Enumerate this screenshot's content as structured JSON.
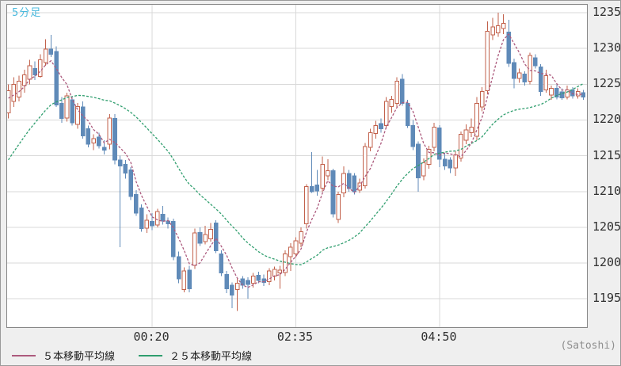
{
  "title": "5分足",
  "unit_label": "(Satoshi)",
  "legend": [
    {
      "label": "５本移動平均線",
      "color": "#ac5a7d"
    },
    {
      "label": "２５本移動平均線",
      "color": "#2f9e6e"
    }
  ],
  "colors": {
    "up": "#c2614b",
    "down": "#5f8ab8",
    "ma5": "#ac5a7d",
    "ma25": "#2f9e6e",
    "grid": "#d9d9d9",
    "title": "#4ab9dd",
    "axis_text": "#303030",
    "unit_text": "#8f8f8f",
    "plot_border": "#858585",
    "background": "#efefef",
    "plot_bg": "#ffffff"
  },
  "chart_data": {
    "type": "candlestick",
    "interval_label": "5分足",
    "x_axis": {
      "tick_labels": [
        "00:20",
        "02:35",
        "04:50"
      ],
      "tick_candle_indices": [
        27,
        54,
        81
      ]
    },
    "y_axis": {
      "min": 1195,
      "max": 1235,
      "ticks": [
        1235,
        1230,
        1225,
        1220,
        1215,
        1210,
        1205,
        1200,
        1195
      ],
      "unit": "Satoshi"
    },
    "series_legend": [
      "５本移動平均線",
      "２５本移動平均線"
    ],
    "ma5_period": 5,
    "ma25_period": 25,
    "ma_seed_closes": [
      1197.0,
      1198.5,
      1200.0,
      1202.0,
      1204.0,
      1206.0,
      1208.0,
      1210.0,
      1212.0,
      1213.5,
      1215.0,
      1216.5,
      1217.5,
      1218.5,
      1219.5,
      1220.5,
      1221.0,
      1221.5,
      1222.0,
      1222.5,
      1222.8,
      1223.0,
      1222.8,
      1222.5
    ],
    "candles_ohlc": [
      [
        1221.0,
        1225.0,
        1220.2,
        1224.1
      ],
      [
        1222.6,
        1226.0,
        1221.8,
        1225.0
      ],
      [
        1223.2,
        1226.2,
        1222.6,
        1225.4
      ],
      [
        1224.8,
        1227.0,
        1223.8,
        1226.3
      ],
      [
        1225.7,
        1228.4,
        1225.0,
        1227.6
      ],
      [
        1227.2,
        1228.2,
        1225.6,
        1226.3
      ],
      [
        1226.1,
        1229.2,
        1225.9,
        1228.4
      ],
      [
        1228.0,
        1231.3,
        1227.6,
        1229.9
      ],
      [
        1229.9,
        1231.9,
        1228.8,
        1229.2
      ],
      [
        1229.6,
        1230.3,
        1221.8,
        1222.1
      ],
      [
        1222.3,
        1223.2,
        1219.6,
        1220.2
      ],
      [
        1220.3,
        1223.8,
        1219.8,
        1223.4
      ],
      [
        1222.8,
        1223.2,
        1219.2,
        1219.6
      ],
      [
        1219.4,
        1222.4,
        1218.8,
        1221.9
      ],
      [
        1221.8,
        1222.6,
        1217.4,
        1217.8
      ],
      [
        1218.8,
        1219.2,
        1216.2,
        1216.6
      ],
      [
        1216.8,
        1218.0,
        1215.8,
        1217.4
      ],
      [
        1217.6,
        1218.2,
        1216.0,
        1216.4
      ],
      [
        1216.2,
        1217.2,
        1215.2,
        1215.8
      ],
      [
        1216.6,
        1220.8,
        1215.9,
        1220.3
      ],
      [
        1220.2,
        1220.8,
        1213.8,
        1214.4
      ],
      [
        1214.4,
        1215.0,
        1202.2,
        1213.6
      ],
      [
        1213.8,
        1214.4,
        1211.8,
        1212.6
      ],
      [
        1213.0,
        1213.4,
        1208.8,
        1209.3
      ],
      [
        1209.6,
        1210.2,
        1206.6,
        1207.0
      ],
      [
        1207.7,
        1208.2,
        1204.4,
        1204.8
      ],
      [
        1204.9,
        1206.8,
        1204.2,
        1206.0
      ],
      [
        1205.8,
        1207.0,
        1204.6,
        1205.2
      ],
      [
        1205.3,
        1207.6,
        1205.0,
        1207.2
      ],
      [
        1206.8,
        1208.0,
        1205.4,
        1205.9
      ],
      [
        1205.9,
        1206.4,
        1204.8,
        1205.5
      ],
      [
        1205.8,
        1206.2,
        1200.4,
        1200.9
      ],
      [
        1200.9,
        1201.6,
        1197.2,
        1197.8
      ],
      [
        1196.3,
        1199.4,
        1195.9,
        1198.9
      ],
      [
        1199.0,
        1199.6,
        1195.9,
        1196.4
      ],
      [
        1199.7,
        1204.8,
        1199.2,
        1204.2
      ],
      [
        1204.3,
        1205.0,
        1202.4,
        1202.8
      ],
      [
        1203.0,
        1205.2,
        1202.6,
        1204.0
      ],
      [
        1203.4,
        1205.6,
        1203.0,
        1204.7
      ],
      [
        1205.6,
        1206.0,
        1201.4,
        1201.7
      ],
      [
        1201.3,
        1201.8,
        1198.2,
        1198.6
      ],
      [
        1198.4,
        1198.9,
        1195.8,
        1196.4
      ],
      [
        1196.9,
        1197.3,
        1193.7,
        1195.5
      ],
      [
        1196.3,
        1197.8,
        1193.3,
        1197.2
      ],
      [
        1197.8,
        1198.2,
        1196.4,
        1196.9
      ],
      [
        1197.6,
        1198.0,
        1195.0,
        1197.0
      ],
      [
        1197.2,
        1198.6,
        1196.6,
        1198.2
      ],
      [
        1198.3,
        1198.8,
        1197.2,
        1197.6
      ],
      [
        1197.8,
        1198.4,
        1196.8,
        1197.3
      ],
      [
        1197.4,
        1199.3,
        1196.9,
        1198.9
      ],
      [
        1198.2,
        1199.5,
        1197.6,
        1199.1
      ],
      [
        1198.6,
        1199.6,
        1196.4,
        1199.0
      ],
      [
        1198.7,
        1201.8,
        1198.2,
        1201.3
      ],
      [
        1200.9,
        1202.8,
        1198.9,
        1202.2
      ],
      [
        1201.3,
        1203.6,
        1200.8,
        1203.1
      ],
      [
        1202.8,
        1205.0,
        1202.2,
        1204.4
      ],
      [
        1205.5,
        1211.0,
        1204.8,
        1210.7
      ],
      [
        1210.7,
        1215.5,
        1209.8,
        1210.0
      ],
      [
        1210.9,
        1213.0,
        1209.4,
        1210.1
      ],
      [
        1210.5,
        1214.9,
        1210.0,
        1213.8
      ],
      [
        1212.2,
        1214.5,
        1211.6,
        1212.9
      ],
      [
        1212.9,
        1213.2,
        1206.4,
        1206.9
      ],
      [
        1206.1,
        1210.0,
        1205.6,
        1209.6
      ],
      [
        1209.8,
        1213.5,
        1209.2,
        1212.5
      ],
      [
        1212.5,
        1213.0,
        1210.0,
        1210.4
      ],
      [
        1212.2,
        1212.6,
        1209.6,
        1210.0
      ],
      [
        1210.2,
        1211.8,
        1209.8,
        1211.2
      ],
      [
        1210.8,
        1216.8,
        1210.4,
        1216.3
      ],
      [
        1216.2,
        1218.8,
        1215.6,
        1218.2
      ],
      [
        1218.1,
        1219.9,
        1217.4,
        1219.2
      ],
      [
        1219.5,
        1220.2,
        1218.2,
        1218.8
      ],
      [
        1219.2,
        1223.2,
        1218.8,
        1222.6
      ],
      [
        1221.9,
        1223.4,
        1221.0,
        1222.9
      ],
      [
        1222.3,
        1226.0,
        1221.8,
        1225.4
      ],
      [
        1225.7,
        1226.4,
        1222.0,
        1222.3
      ],
      [
        1222.3,
        1222.8,
        1218.9,
        1219.2
      ],
      [
        1219.2,
        1220.0,
        1215.8,
        1216.3
      ],
      [
        1216.6,
        1217.0,
        1210.0,
        1211.9
      ],
      [
        1212.2,
        1214.6,
        1211.6,
        1214.0
      ],
      [
        1213.8,
        1216.4,
        1213.2,
        1215.9
      ],
      [
        1216.2,
        1219.6,
        1215.6,
        1219.0
      ],
      [
        1218.9,
        1219.3,
        1213.4,
        1214.5
      ],
      [
        1214.5,
        1215.4,
        1213.0,
        1213.6
      ],
      [
        1214.4,
        1214.8,
        1212.6,
        1213.3
      ],
      [
        1213.3,
        1215.6,
        1212.2,
        1215.1
      ],
      [
        1214.7,
        1218.4,
        1214.2,
        1218.0
      ],
      [
        1217.2,
        1219.4,
        1216.6,
        1218.6
      ],
      [
        1218.2,
        1220.2,
        1217.6,
        1219.0
      ],
      [
        1217.7,
        1223.2,
        1217.2,
        1222.3
      ],
      [
        1221.8,
        1224.6,
        1221.2,
        1224.0
      ],
      [
        1224.1,
        1233.8,
        1223.6,
        1232.4
      ],
      [
        1231.9,
        1234.3,
        1231.2,
        1233.0
      ],
      [
        1232.2,
        1235.0,
        1231.6,
        1233.2
      ],
      [
        1232.8,
        1234.8,
        1232.0,
        1233.5
      ],
      [
        1232.3,
        1234.0,
        1227.4,
        1227.9
      ],
      [
        1228.0,
        1228.6,
        1224.4,
        1225.8
      ],
      [
        1225.8,
        1227.2,
        1225.2,
        1226.6
      ],
      [
        1226.4,
        1226.8,
        1224.8,
        1225.3
      ],
      [
        1225.4,
        1229.4,
        1225.0,
        1229.0
      ],
      [
        1228.7,
        1229.2,
        1227.2,
        1227.6
      ],
      [
        1227.4,
        1227.8,
        1223.4,
        1224.0
      ],
      [
        1224.2,
        1227.0,
        1223.8,
        1226.2
      ],
      [
        1223.5,
        1224.8,
        1222.8,
        1224.4
      ],
      [
        1224.4,
        1225.0,
        1222.9,
        1223.2
      ],
      [
        1223.9,
        1224.4,
        1222.8,
        1223.1
      ],
      [
        1223.2,
        1224.8,
        1222.9,
        1224.2
      ],
      [
        1224.2,
        1224.6,
        1223.0,
        1223.4
      ],
      [
        1223.4,
        1224.4,
        1223.0,
        1224.0
      ],
      [
        1223.8,
        1224.2,
        1222.8,
        1223.2
      ]
    ]
  }
}
